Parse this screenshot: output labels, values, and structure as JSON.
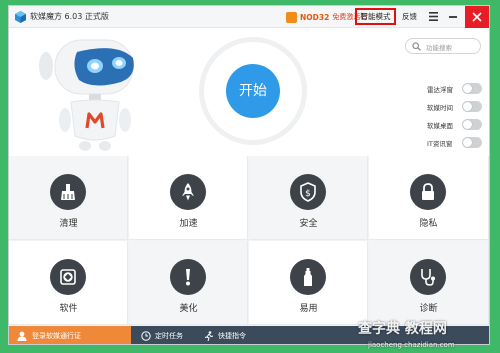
{
  "titlebar": {
    "app_title": "软媒魔方 6.03 正式版",
    "promo_nod": "NOD32",
    "promo_text": "免费激活码",
    "mode_button": "智能模式",
    "feedback": "反馈",
    "icons": [
      "cube-logo-icon",
      "menu-icon",
      "minimize-icon",
      "close-icon"
    ]
  },
  "hero": {
    "start_button": "开始",
    "search_placeholder": "功能搜索",
    "toggles": [
      {
        "label": "雷达浮窗",
        "on": false
      },
      {
        "label": "软媒时间",
        "on": false
      },
      {
        "label": "软媒桌面",
        "on": false
      },
      {
        "label": "IT资讯窗",
        "on": false
      }
    ]
  },
  "tiles": [
    {
      "label": "清理",
      "icon": "broom-icon"
    },
    {
      "label": "加速",
      "icon": "rocket-icon"
    },
    {
      "label": "安全",
      "icon": "shield-icon"
    },
    {
      "label": "隐私",
      "icon": "lock-icon"
    },
    {
      "label": "软件",
      "icon": "aperture-icon"
    },
    {
      "label": "美化",
      "icon": "exclamation-icon"
    },
    {
      "label": "易用",
      "icon": "bottle-icon"
    },
    {
      "label": "诊断",
      "icon": "stethoscope-icon"
    }
  ],
  "bottombar": {
    "login": "登录软媒通行证",
    "scheduled": "定时任务",
    "quick_cmd": "快捷指令"
  },
  "watermark": {
    "main": "查字典 教程网",
    "url": "jiaocheng.chazidian.com"
  },
  "colors": {
    "accent_blue": "#2f9be8",
    "close_red": "#e81c24",
    "login_orange": "#f0883a",
    "bottom_bar": "#3b4b5c",
    "tile_icon": "#3d4349"
  }
}
